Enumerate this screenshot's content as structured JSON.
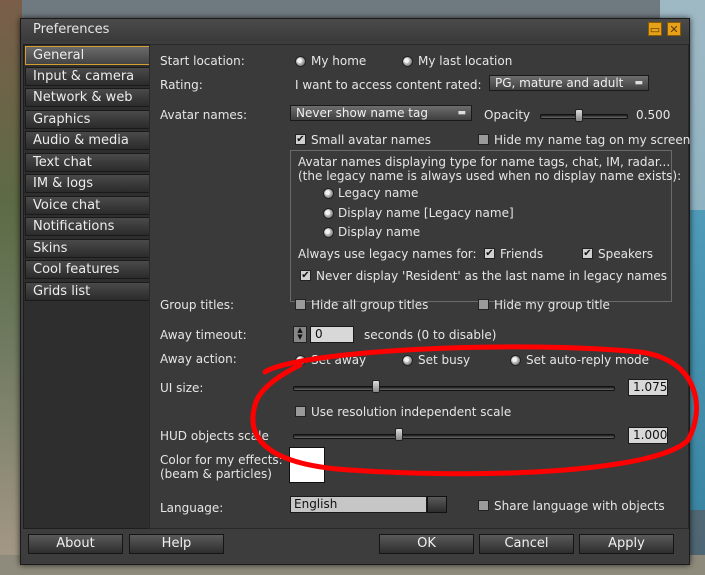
{
  "window": {
    "title": "Preferences"
  },
  "sidebar": {
    "items": [
      {
        "label": "General"
      },
      {
        "label": "Input & camera"
      },
      {
        "label": "Network & web"
      },
      {
        "label": "Graphics"
      },
      {
        "label": "Audio & media"
      },
      {
        "label": "Text chat"
      },
      {
        "label": "IM & logs"
      },
      {
        "label": "Voice chat"
      },
      {
        "label": "Notifications"
      },
      {
        "label": "Skins"
      },
      {
        "label": "Cool features"
      },
      {
        "label": "Grids list"
      }
    ]
  },
  "general": {
    "start_location": {
      "label": "Start location:",
      "options": [
        "My home",
        "My last location"
      ],
      "selected": "My last location"
    },
    "rating": {
      "label": "Rating:",
      "prompt": "I want to access content rated:",
      "value": "PG, mature and adult"
    },
    "avatar_names": {
      "label": "Avatar names:",
      "tag_mode": "Never show name tag",
      "opacity_label": "Opacity",
      "opacity_value": "0.500",
      "opacity_level": 0.5,
      "small_names": "Small avatar names",
      "hide_my_tag": "Hide my name tag on my screen"
    },
    "display_names": {
      "desc_line1": "Avatar names displaying type for name tags, chat, IM, radar...",
      "desc_line2": "(the legacy name is always used when no display name exists):",
      "options": [
        "Legacy name",
        "Display name [Legacy name]",
        "Display name"
      ],
      "legacy_for_label": "Always use legacy names for:",
      "friends": "Friends",
      "speakers": "Speakers",
      "never_resident": "Never display 'Resident' as the last name in legacy names"
    },
    "group_titles": {
      "label": "Group titles:",
      "hide_all": "Hide all group titles",
      "hide_mine": "Hide my group title"
    },
    "away_timeout": {
      "label": "Away timeout:",
      "value": "0",
      "suffix": "seconds (0 to disable)"
    },
    "away_action": {
      "label": "Away action:",
      "options": [
        "Set away",
        "Set busy",
        "Set auto-reply mode"
      ]
    },
    "ui_size": {
      "label": "UI size:",
      "value": "1.075",
      "level": 0.26,
      "independent": "Use resolution independent scale"
    },
    "hud_scale": {
      "label": "HUD objects scale",
      "value": "1.000",
      "level": 0.33
    },
    "effects_color": {
      "label1": "Color for my effects:",
      "label2": "(beam & particles)",
      "color": "#ffffff"
    },
    "language": {
      "label": "Language:",
      "value": "English",
      "share": "Share language with objects"
    }
  },
  "buttons": {
    "about": "About",
    "help": "Help",
    "ok": "OK",
    "cancel": "Cancel",
    "apply": "Apply"
  },
  "colors": {
    "accent": "#d59c2f",
    "annotation": "#ff0000",
    "window_bg": "#3d3d3d"
  }
}
